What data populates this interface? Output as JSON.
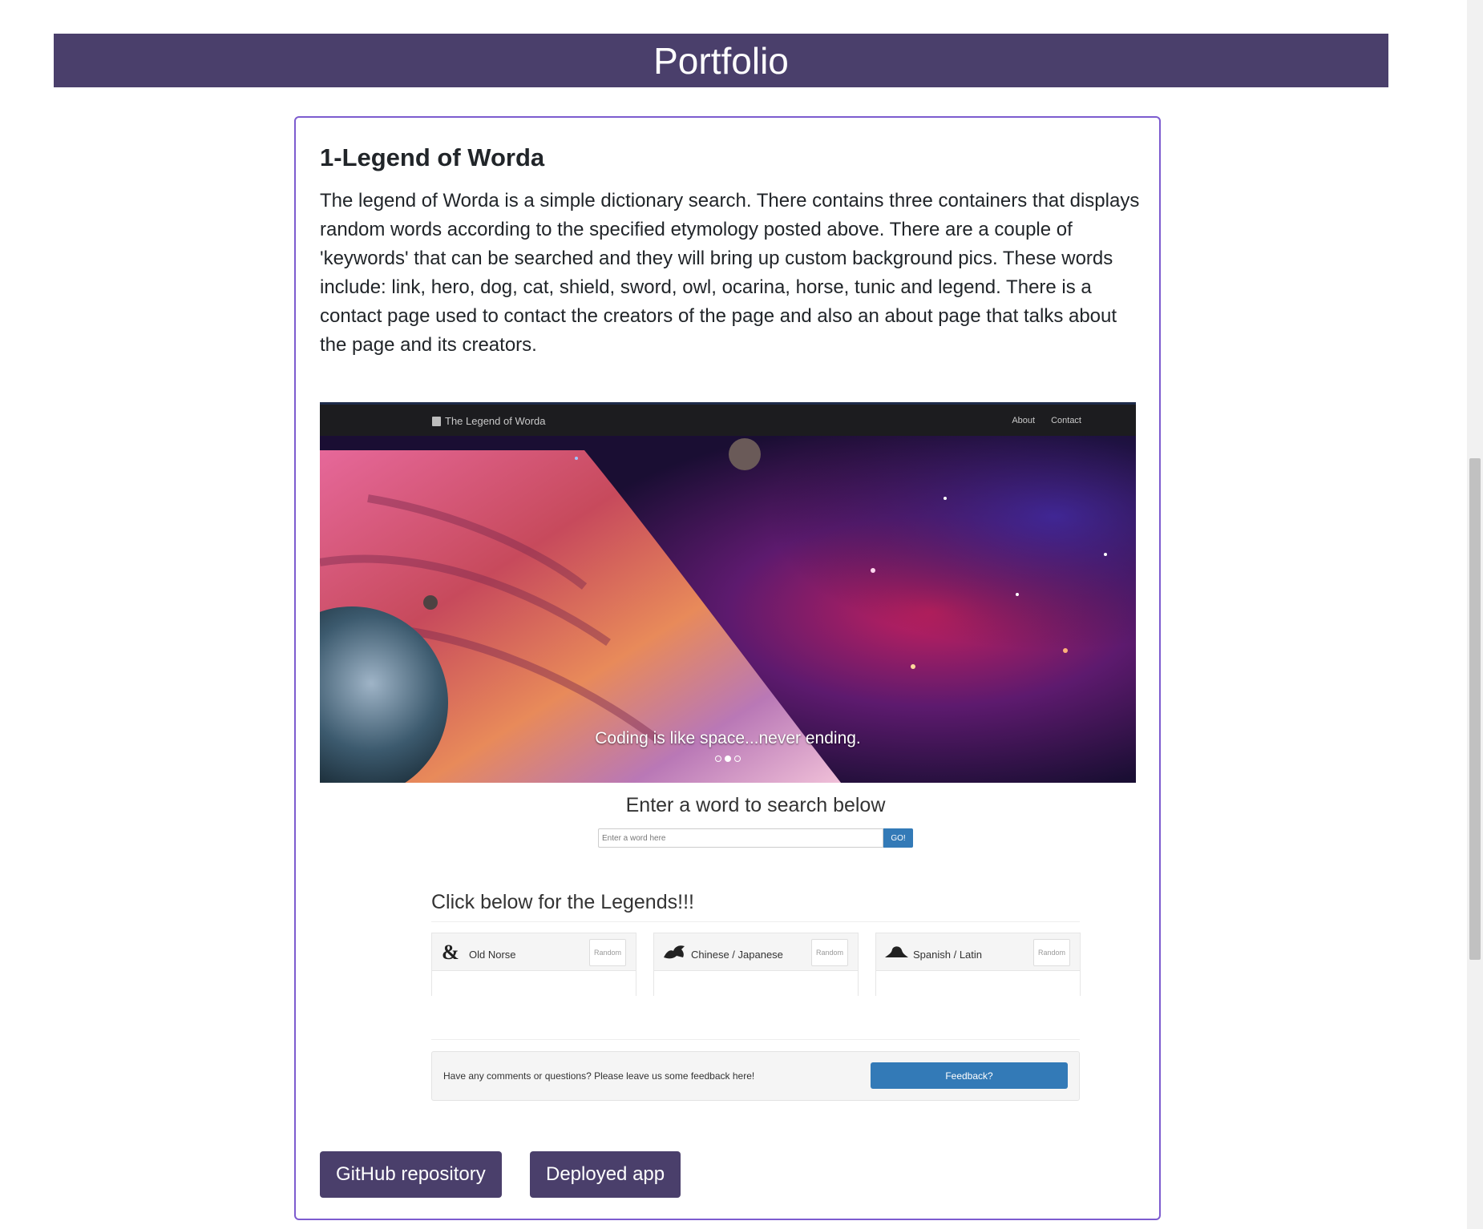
{
  "header": {
    "title": "Portfolio"
  },
  "project": {
    "title": "1-Legend of Worda",
    "description": "The legend of Worda is a simple dictionary search. There contains three containers that displays random words according to the specified etymology posted above. There are a couple of 'keywords' that can be searched and they will bring up custom background pics. These words include: link, hero, dog, cat, shield, sword, owl, ocarina, horse, tunic and legend. There is a contact page used to contact the creators of the page and also an about page that talks about the page and its creators.",
    "screenshot": {
      "brand": "The Legend of Worda",
      "nav": [
        "About",
        "Contact"
      ],
      "hero_caption": "Coding is like space...never ending.",
      "search_title": "Enter a word to search below",
      "search_placeholder": "Enter a word here",
      "search_button": "GO!",
      "legends_title": "Click below for the Legends!!!",
      "legends": [
        {
          "name": "Old Norse",
          "button": "Random",
          "icon": "ampersand-icon"
        },
        {
          "name": "Chinese / Japanese",
          "button": "Random",
          "icon": "dragon-icon"
        },
        {
          "name": "Spanish / Latin",
          "button": "Random",
          "icon": "hat-icon"
        }
      ],
      "feedback_text": "Have any comments or questions? Please leave us some feedback here!",
      "feedback_button": "Feedback?"
    },
    "buttons": {
      "github": "GitHub repository",
      "deployed": "Deployed app"
    }
  },
  "colors": {
    "header_bg": "#4a3f6b",
    "card_border": "#7d5ccf",
    "button_bg": "#4a3f6b",
    "bootstrap_primary": "#337ab7"
  }
}
